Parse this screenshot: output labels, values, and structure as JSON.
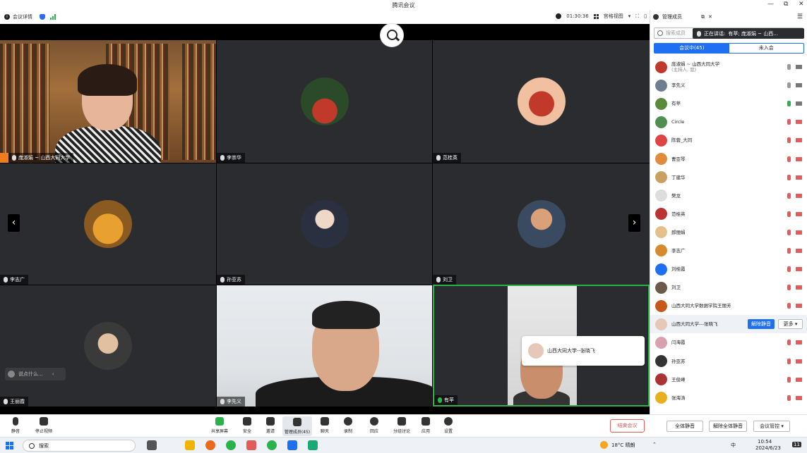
{
  "window": {
    "title": "腾讯会议",
    "controls": [
      "—",
      "⧉",
      "✕"
    ]
  },
  "topbar": {
    "meeting_details": "会议详情",
    "timer": "01:30:36",
    "view_label": "宫格视图",
    "manage_members": "管理成员"
  },
  "tiles": [
    {
      "name": "庞淑娟 ~ 山西大同大学"
    },
    {
      "name": "李崇华"
    },
    {
      "name": "范桂英"
    },
    {
      "name": "李志广"
    },
    {
      "name": "孙亚苏"
    },
    {
      "name": "刘卫"
    },
    {
      "name": "王丽霞"
    },
    {
      "name": "李先义"
    },
    {
      "name": "有苹"
    }
  ],
  "chat_placeholder": "说点什么...",
  "speaker_card": {
    "name": "山西大同大学--张晓飞"
  },
  "panel": {
    "search_placeholder": "搜索成员",
    "speaking_label": "正在讲话:",
    "speaking_names": "有苹; 庞淑娟 ~ 山西...",
    "tab_in_meeting": "会议中(45)",
    "tab_not_joined": "未入会",
    "participants": [
      {
        "name": "庞淑娟 ~ 山西大同大学",
        "role": "(主持人, 我)",
        "mic": "on",
        "color": "#c0392b"
      },
      {
        "name": "李先义",
        "mic": "on",
        "color": "#6d7f8f"
      },
      {
        "name": "有苹",
        "mic": "green",
        "color": "#5b8a3a"
      },
      {
        "name": "Circle",
        "mic": "muted",
        "color": "#4f8f4f"
      },
      {
        "name": "陈蓉_大同",
        "mic": "muted",
        "color": "#d44"
      },
      {
        "name": "曹亚琴",
        "mic": "muted",
        "color": "#e08a3c"
      },
      {
        "name": "丁建华",
        "mic": "muted",
        "color": "#c9a060"
      },
      {
        "name": "樊龙",
        "mic": "muted",
        "color": "#ddd"
      },
      {
        "name": "范桂英",
        "mic": "muted",
        "color": "#b33"
      },
      {
        "name": "郝丽娟",
        "mic": "muted",
        "color": "#e6c08a"
      },
      {
        "name": "李志广",
        "mic": "muted",
        "color": "#d68a2e"
      },
      {
        "name": "刘桂霞",
        "mic": "muted",
        "color": "#1e6ff1"
      },
      {
        "name": "刘卫",
        "mic": "muted",
        "color": "#6b5a4a"
      },
      {
        "name": "山西大同大学数据学院王丽芳",
        "mic": "muted",
        "color": "#c65a1a"
      },
      {
        "name": "山西大同大学---张晓飞",
        "mic": "muted",
        "color": "#e6c8b8",
        "highlight": true
      },
      {
        "name": "闫海霞",
        "mic": "muted",
        "color": "#d9a0b0"
      },
      {
        "name": "孙亚苏",
        "mic": "muted",
        "color": "#333"
      },
      {
        "name": "王俊峰",
        "mic": "muted",
        "color": "#a33"
      },
      {
        "name": "张海涛",
        "mic": "muted",
        "color": "#e8b020"
      }
    ],
    "unmute_btn": "解除静音",
    "more_btn": "更多 ▾"
  },
  "toolbar": {
    "mute": "静音",
    "stop_video": "停止视频",
    "share": "共享屏幕",
    "security": "安全",
    "invite": "邀请",
    "manage": "管理成员(45)",
    "chat": "聊天",
    "record": "录制",
    "reactions": "回应",
    "breakout": "分组讨论",
    "apps": "应用",
    "settings": "设置",
    "end_meeting": "结束会议",
    "mute_all": "全体静音",
    "unmute_all": "解除全体静音",
    "meeting_control": "会议管控 ▾"
  },
  "taskbar": {
    "search": "搜索",
    "weather": "18°C 晴朗",
    "time": "10:54",
    "date": "2024/6/23",
    "ime": "中",
    "notif": "11"
  }
}
